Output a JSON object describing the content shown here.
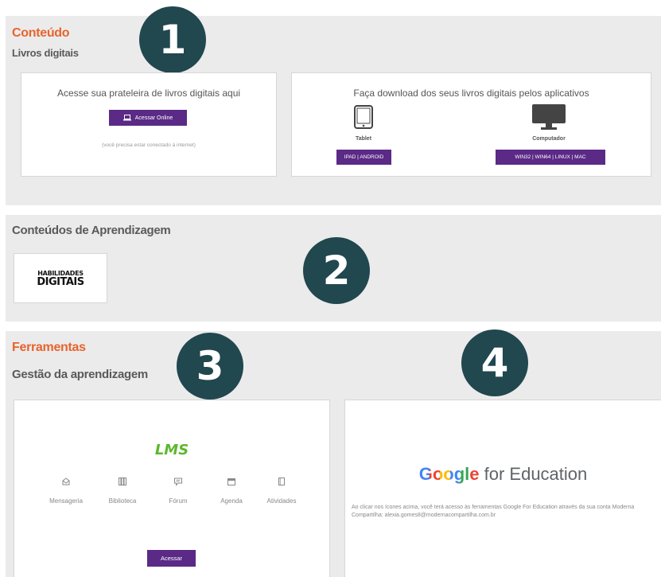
{
  "section1": {
    "title": "Conteúdo",
    "subtitle": "Livros digitais",
    "badge": "1",
    "card_left": {
      "heading": "Acesse sua prateleira de livros digitais aqui",
      "button": "Acessar Online",
      "note": "(você precisa estar conectado à internet)"
    },
    "card_right": {
      "heading": "Faça download dos seus livros digitais pelos aplicativos",
      "tablet_label": "Tablet",
      "tablet_button": "IPAD | ANDROID",
      "computer_label": "Computador",
      "computer_button": "WIN32 | WIN64 | LINUX | MAC"
    }
  },
  "section2": {
    "title": "Conteúdos de Aprendizagem",
    "badge": "2",
    "logo_line1": "HABILIDADES",
    "logo_line2": "DIGITAIS"
  },
  "section3": {
    "title": "Ferramentas",
    "subtitle": "Gestão da aprendizagem",
    "badge3": "3",
    "badge4": "4",
    "lms": {
      "logo": "LMS",
      "items": [
        {
          "label": "Mensageria",
          "icon": "message-icon"
        },
        {
          "label": "Biblioteca",
          "icon": "library-icon"
        },
        {
          "label": "Fórum",
          "icon": "forum-icon"
        },
        {
          "label": "Agenda",
          "icon": "calendar-icon"
        },
        {
          "label": "Atividades",
          "icon": "activity-icon"
        }
      ],
      "button": "Acessar"
    },
    "google": {
      "logo_word": "Google",
      "logo_suffix": "for Education",
      "note": "Ao clicar nos ícones acima, você terá acesso às ferramentas Google For Education através da sua conta Moderna Compartilha: alexia.gomes8@modernacompartilha.com.br"
    }
  },
  "colors": {
    "accent_orange": "#e8632e",
    "button_purple": "#5a2a86",
    "badge_teal": "#21474f",
    "lms_green": "#5cb82c"
  }
}
